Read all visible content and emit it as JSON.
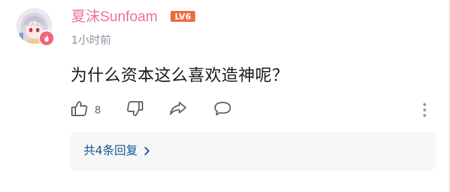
{
  "comment": {
    "username": "夏沫Sunfoam",
    "level_text": "LV6",
    "timestamp": "1小时前",
    "text": "为什么资本这么喜欢造神呢？",
    "like_count": "8",
    "reply_summary": "共4条回复"
  },
  "colors": {
    "username": "#f06e9b",
    "level_badge": "#f06a3c",
    "reply_link": "#16578f",
    "icon": "#61666d"
  },
  "icons": {
    "avatar_badge": "flame-icon",
    "like": "thumbs-up-icon",
    "dislike": "thumbs-down-icon",
    "share": "share-arrow-icon",
    "reply": "chat-bubble-icon",
    "more": "vertical-dots-icon",
    "chevron": "chevron-right-icon"
  }
}
